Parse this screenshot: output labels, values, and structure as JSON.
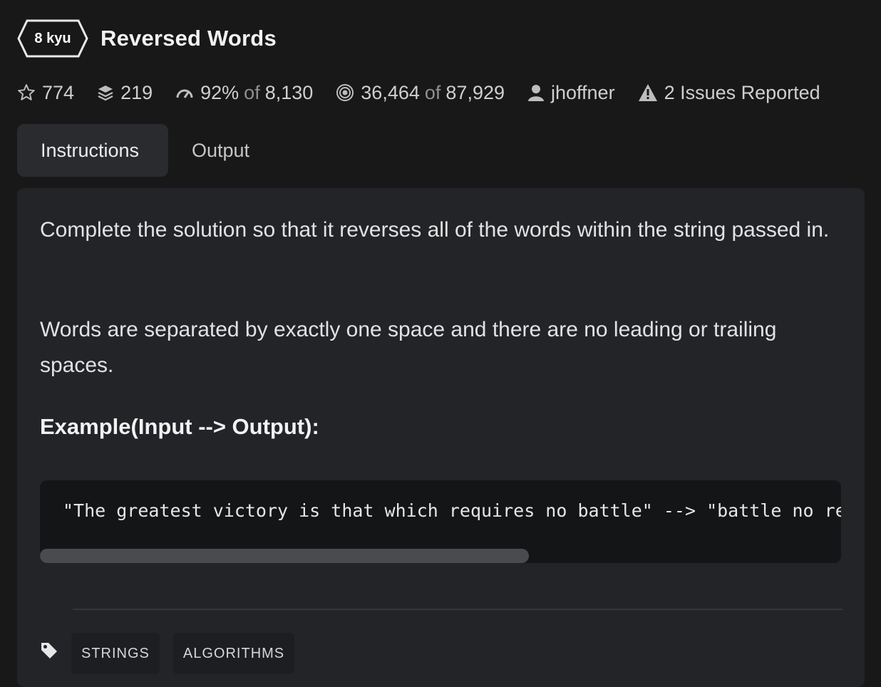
{
  "kata": {
    "rank": "8 kyu",
    "title": "Reversed Words"
  },
  "stats": {
    "stars": "774",
    "collections": "219",
    "satisfaction_pct": "92%",
    "satisfaction_of": "of",
    "satisfaction_votes": "8,130",
    "completed": "36,464",
    "completed_of": "of",
    "attempted": "87,929",
    "author": "jhoffner",
    "issues": "2 Issues Reported"
  },
  "icons": {
    "star": "star-outline-icon",
    "collections": "layers-icon",
    "satisfaction": "gauge-icon",
    "completions": "target-icon",
    "author": "user-icon",
    "issues": "warning-icon",
    "tags": "tag-icon"
  },
  "tabs": [
    {
      "label": "Instructions",
      "active": true
    },
    {
      "label": "Output",
      "active": false
    }
  ],
  "description": {
    "paragraph_1": "Complete the solution so that it reverses all of the words within the string passed in.",
    "paragraph_2": "Words are separated by exactly one space and there are no leading or trailing spaces.",
    "example_heading": "Example(Input --> Output):",
    "code": "\"The greatest victory is that which requires no battle\" --> \"battle no requires which that is victory greatest The\""
  },
  "code_scroll": {
    "thumb_fraction": 0.61
  },
  "tags": [
    "STRINGS",
    "ALGORITHMS"
  ],
  "colors": {
    "background": "#181818",
    "panel": "#232428",
    "code_bg": "#141516",
    "tab_active": "#2a2b2f",
    "text": "#e6e6e6",
    "muted": "#8f8f8f"
  }
}
